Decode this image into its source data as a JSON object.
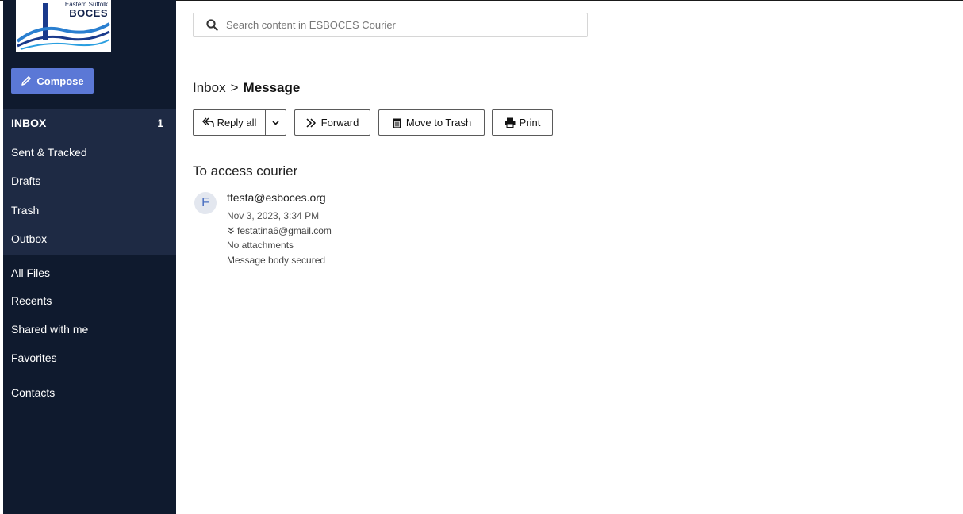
{
  "brand": {
    "line1": "Eastern Suffolk",
    "line2": "BOCES"
  },
  "compose": {
    "label": "Compose"
  },
  "mailboxes": [
    {
      "label": "INBOX",
      "count": "1",
      "active": true
    },
    {
      "label": "Sent & Tracked"
    },
    {
      "label": "Drafts"
    },
    {
      "label": "Trash"
    },
    {
      "label": "Outbox"
    }
  ],
  "files": [
    {
      "label": "All Files"
    },
    {
      "label": "Recents"
    },
    {
      "label": "Shared with me"
    },
    {
      "label": "Favorites"
    }
  ],
  "contacts": {
    "label": "Contacts"
  },
  "search": {
    "placeholder": "Search content in ESBOCES Courier",
    "value": ""
  },
  "breadcrumb": {
    "parent": "Inbox",
    "separator": ">",
    "current": "Message"
  },
  "toolbar": {
    "reply_all": "Reply all",
    "forward": "Forward",
    "move_to_trash": "Move to Trash",
    "print": "Print"
  },
  "message": {
    "subject": "To access courier",
    "avatar_initial": "F",
    "sender": "tfesta@esboces.org",
    "date": "Nov 3, 2023, 3:34 PM",
    "recipient": "festatina6@gmail.com",
    "attachments": "No attachments",
    "body_status": "Message body secured"
  },
  "colors": {
    "sidebar_bg": "#0f1a2e",
    "sidebar_group_bg": "#1e2a44",
    "compose_bg": "#5b78d6",
    "avatar_fg": "#4a6fc1"
  }
}
